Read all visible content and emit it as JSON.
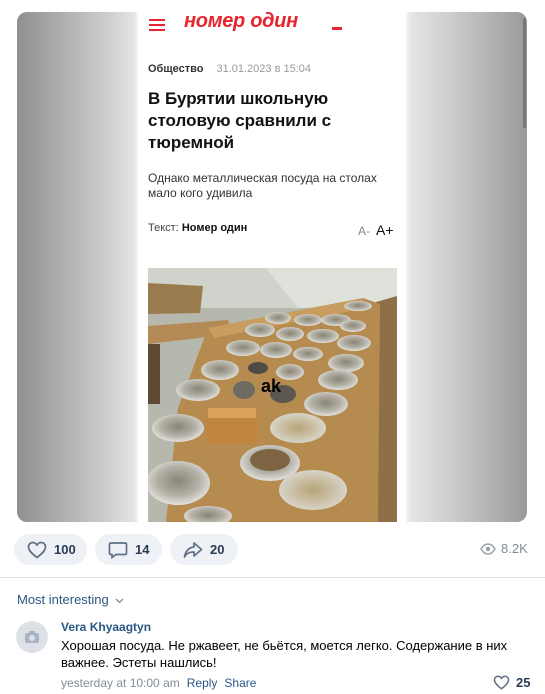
{
  "article": {
    "site_name": "номер один",
    "category": "Общество",
    "date": "31.01.2023 в 15:04",
    "headline": "В Бурятии школьную столовую сравнили с тюремной",
    "lead": "Однако металлическая посуда на столах мало кого удивила",
    "byline_label": "Текст:",
    "byline_author": "Номер один",
    "font_smaller": "A-",
    "font_larger": "A+",
    "photo_watermark": "ak"
  },
  "actions": {
    "likes": "100",
    "comments": "14",
    "shares": "20",
    "views": "8.2K"
  },
  "comments": {
    "sort_label": "Most interesting",
    "items": [
      {
        "author": "Vera Khyaagtyn",
        "text": "Хорошая посуда. Не ржавеет, не бьётся, моется легко. Содержание в них важнее. Эстеты нашлись!",
        "time": "yesterday at 10:00 am",
        "reply_label": "Reply",
        "share_label": "Share",
        "likes": "25"
      }
    ]
  },
  "colors": {
    "brand_red": "#e8242e",
    "link_blue": "#2a5885",
    "pill_bg": "#eef1f5"
  }
}
